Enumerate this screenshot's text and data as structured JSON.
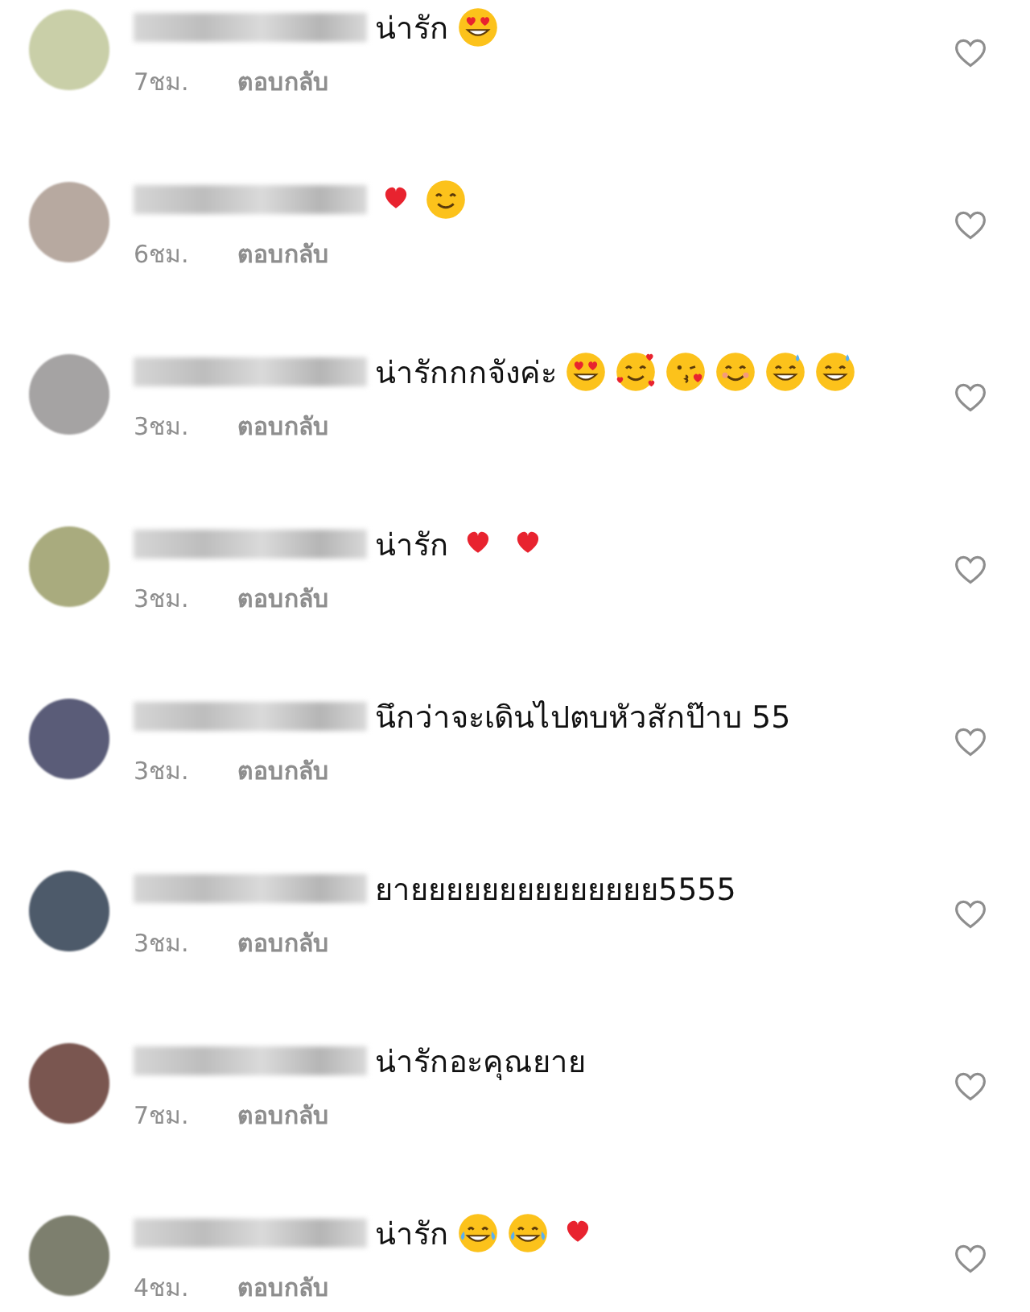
{
  "comments": [
    {
      "color": "#c9cfa8",
      "text": "น่ารัก",
      "emojis": [
        {
          "kind": "heart-eyes"
        }
      ],
      "time": "7ชม.",
      "reply": "ตอบกลับ",
      "liked": false
    },
    {
      "color": "#b7a9a0",
      "emojis": [
        {
          "kind": "heart"
        },
        {
          "kind": "smile"
        }
      ],
      "time": "6ชม.",
      "reply": "ตอบกลับ",
      "liked": false
    },
    {
      "color": "#a5a3a3",
      "text": "น่ารักกกจังค่ะ",
      "emojis": [
        {
          "kind": "heart-eyes"
        },
        {
          "kind": "hearts-face"
        },
        {
          "kind": "kiss"
        },
        {
          "kind": "blush"
        },
        {
          "kind": "sweat-grin"
        },
        {
          "kind": "sweat-grin"
        }
      ],
      "time": "3ชม.",
      "reply": "ตอบกลับ",
      "liked": false
    },
    {
      "color": "#a9ab7e",
      "text": "น่ารัก",
      "emojis": [
        {
          "kind": "heart"
        },
        {
          "kind": "heart"
        }
      ],
      "time": "3ชม.",
      "reply": "ตอบกลับ",
      "liked": false
    },
    {
      "color": "#5a5c78",
      "text": "นึกว่าจะเดินไปตบหัวสักป๊าบ  55",
      "time": "3ชม.",
      "reply": "ตอบกลับ",
      "liked": false
    },
    {
      "color": "#4d5a6a",
      "text": "ยายยยยยยยยยยยยยย5555",
      "time": "3ชม.",
      "reply": "ตอบกลับ",
      "liked": false
    },
    {
      "color": "#7a5650",
      "text": "น่ารักอะคุณยาย",
      "time": "7ชม.",
      "reply": "ตอบกลับ",
      "liked": false
    },
    {
      "color": "#7d7f6e",
      "text": "น่ารัก",
      "emojis": [
        {
          "kind": "tears-joy"
        },
        {
          "kind": "tears-joy"
        },
        {
          "kind": "heart"
        }
      ],
      "time": "4ชม.",
      "reply": "ตอบกลับ",
      "liked": false
    }
  ]
}
